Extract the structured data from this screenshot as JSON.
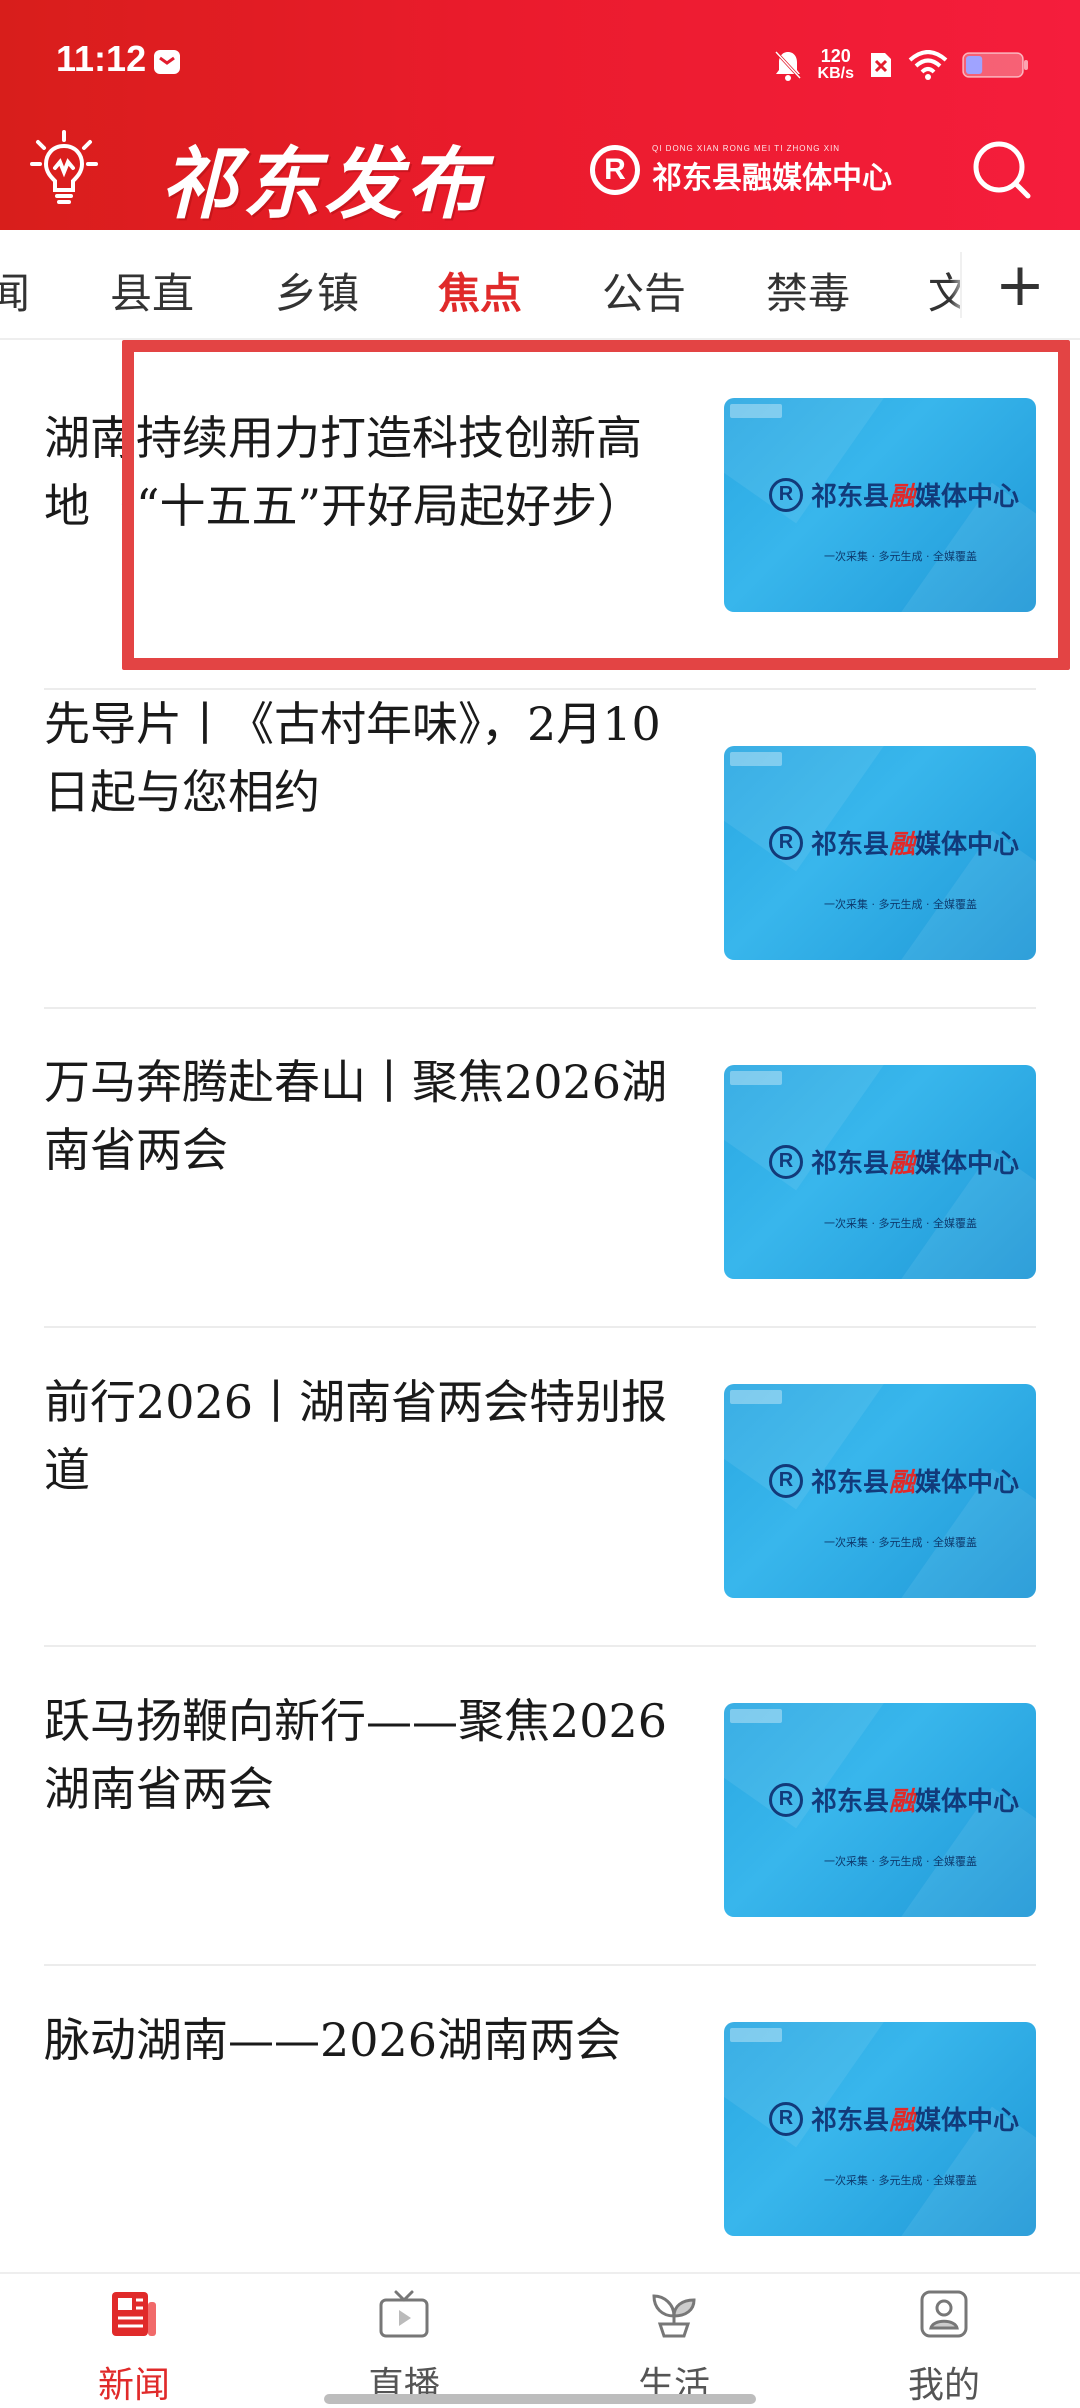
{
  "status_bar": {
    "time": "11:12",
    "net_speed_value": "120",
    "net_speed_unit": "KB/s",
    "battery_level": 0.3
  },
  "header": {
    "title": "祁东发布",
    "brand_letter": "R",
    "brand_pinyin": "QI DONG XIAN   RONG MEI TI ZHONG XIN",
    "brand_name": "祁东县融媒体中心",
    "accent_color": "#e21c2d"
  },
  "tabs": [
    {
      "label": "闻",
      "active": false
    },
    {
      "label": "县直",
      "active": false
    },
    {
      "label": "乡镇",
      "active": false
    },
    {
      "label": "焦点",
      "active": true
    },
    {
      "label": "公告",
      "active": false
    },
    {
      "label": "禁毒",
      "active": false
    },
    {
      "label": "文",
      "active": false
    }
  ],
  "tab_add_label": "+",
  "news": [
    {
      "title": "湖南持续用力打造科技创新高地（“十五五”开好局起好步）",
      "thumb_icon": "media-center-thumbnail"
    },
    {
      "title": "先导片丨《古村年味》，2月10日起与您相约",
      "thumb_icon": "media-center-thumbnail"
    },
    {
      "title": "万马奔腾赴春山丨聚焦2026湖南省两会",
      "thumb_icon": "media-center-thumbnail"
    },
    {
      "title": "前行2026丨湖南省两会特别报道",
      "thumb_icon": "media-center-thumbnail"
    },
    {
      "title": "跃马扬鞭向新行——聚焦2026湖南省两会",
      "thumb_icon": "media-center-thumbnail"
    },
    {
      "title": "脉动湖南——2026湖南两会",
      "thumb_icon": "media-center-thumbnail"
    }
  ],
  "thumbnail": {
    "letter": "R",
    "name_a": "祁东县",
    "name_b": "融",
    "name_c": "媒体中心",
    "slogan": "一次采集 · 多元生成 · 全媒覆盖"
  },
  "bottom_nav": [
    {
      "label": "新闻",
      "icon": "newspaper-icon",
      "active": true
    },
    {
      "label": "直播",
      "icon": "tv-play-icon",
      "active": false
    },
    {
      "label": "生活",
      "icon": "plant-icon",
      "active": false
    },
    {
      "label": "我的",
      "icon": "profile-icon",
      "active": false
    }
  ]
}
